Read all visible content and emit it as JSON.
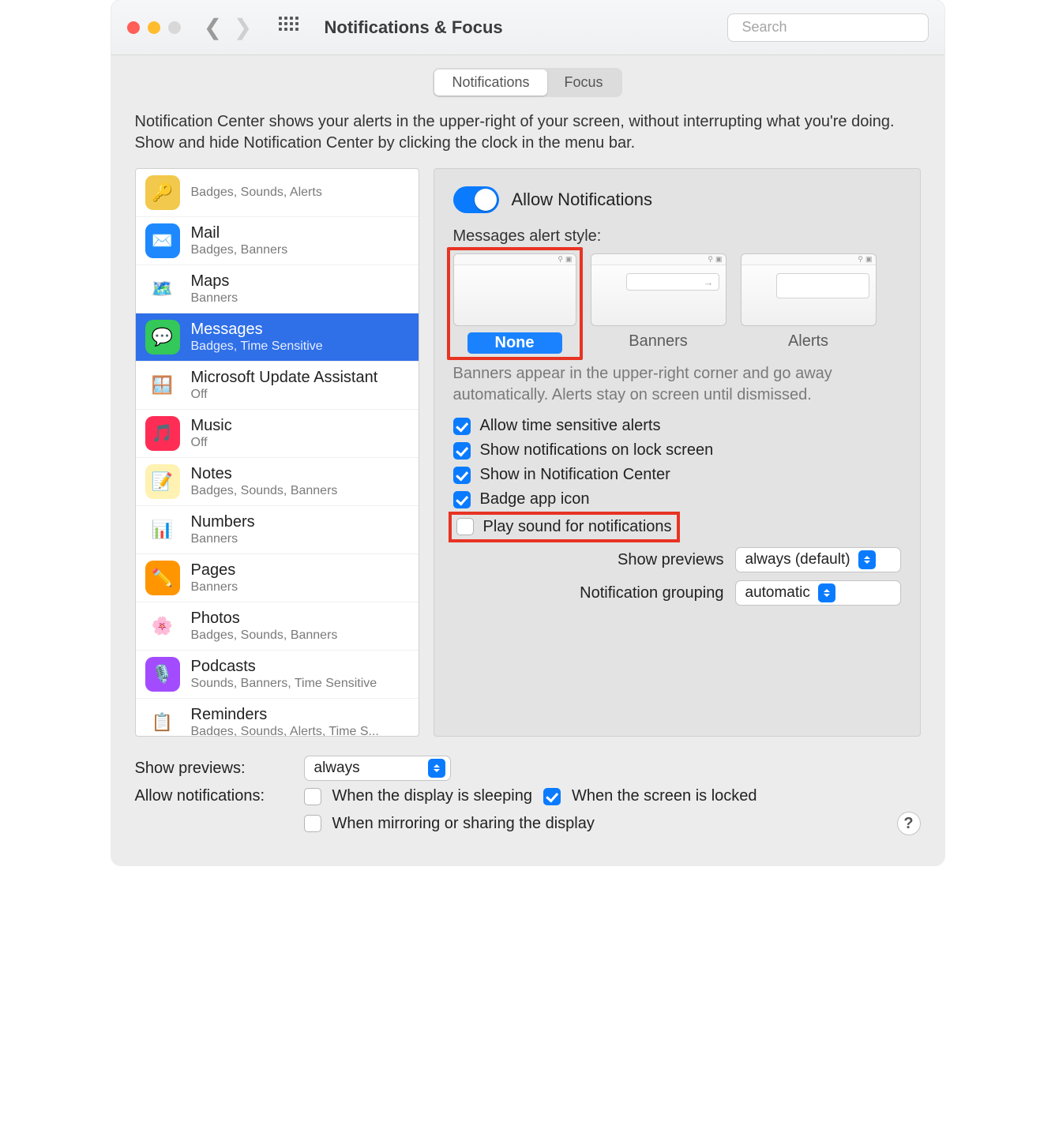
{
  "window": {
    "title": "Notifications & Focus"
  },
  "search": {
    "placeholder": "Search"
  },
  "tabs": {
    "notifications": "Notifications",
    "focus": "Focus"
  },
  "intro": "Notification Center shows your alerts in the upper-right of your screen, without interrupting what you're doing. Show and hide Notification Center by clicking the clock in the menu bar.",
  "apps": [
    {
      "name": "",
      "sub": "Badges, Sounds, Alerts",
      "iconBg": "#f2c94c",
      "glyph": "🔑"
    },
    {
      "name": "Mail",
      "sub": "Badges, Banners",
      "iconBg": "#1e88ff",
      "glyph": "✉️"
    },
    {
      "name": "Maps",
      "sub": "Banners",
      "iconBg": "#ffffff",
      "glyph": "🗺️"
    },
    {
      "name": "Messages",
      "sub": "Badges, Time Sensitive",
      "iconBg": "#34c759",
      "glyph": "💬",
      "selected": true
    },
    {
      "name": "Microsoft Update Assistant",
      "sub": "Off",
      "iconBg": "#ffffff",
      "glyph": "🪟"
    },
    {
      "name": "Music",
      "sub": "Off",
      "iconBg": "#ff2d55",
      "glyph": "🎵"
    },
    {
      "name": "Notes",
      "sub": "Badges, Sounds, Banners",
      "iconBg": "#fff2b2",
      "glyph": "📝"
    },
    {
      "name": "Numbers",
      "sub": "Banners",
      "iconBg": "#ffffff",
      "glyph": "📊"
    },
    {
      "name": "Pages",
      "sub": "Banners",
      "iconBg": "#ff9500",
      "glyph": "✏️"
    },
    {
      "name": "Photos",
      "sub": "Badges, Sounds, Banners",
      "iconBg": "#ffffff",
      "glyph": "🌸"
    },
    {
      "name": "Podcasts",
      "sub": "Sounds, Banners, Time Sensitive",
      "iconBg": "#a34cff",
      "glyph": "🎙️"
    },
    {
      "name": "Reminders",
      "sub": "Badges, Sounds, Alerts, Time S...",
      "iconBg": "#ffffff",
      "glyph": "📋"
    }
  ],
  "detail": {
    "allow_label": "Allow Notifications",
    "style_label": "Messages alert style:",
    "styles": {
      "none": "None",
      "banners": "Banners",
      "alerts": "Alerts"
    },
    "hint": "Banners appear in the upper-right corner and go away automatically. Alerts stay on screen until dismissed.",
    "checks": {
      "time_sensitive": "Allow time sensitive alerts",
      "lock_screen": "Show notifications on lock screen",
      "notif_center": "Show in Notification Center",
      "badge": "Badge app icon",
      "sound": "Play sound for notifications"
    },
    "previews_label": "Show previews",
    "previews_value": "always (default)",
    "grouping_label": "Notification grouping",
    "grouping_value": "automatic"
  },
  "footer": {
    "previews_label": "Show previews:",
    "previews_value": "always",
    "allow_label": "Allow notifications:",
    "opt_display_sleep": "When the display is sleeping",
    "opt_screen_locked": "When the screen is locked",
    "opt_mirroring": "When mirroring or sharing the display"
  }
}
